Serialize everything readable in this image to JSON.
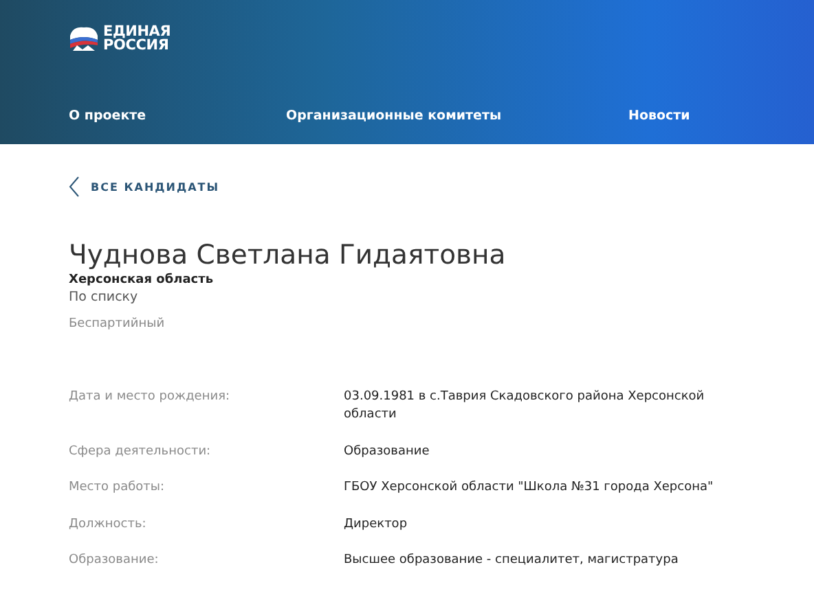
{
  "header": {
    "logo_lines": [
      "ЕДИНАЯ",
      "РОССИЯ"
    ],
    "nav": [
      {
        "label": "О проекте"
      },
      {
        "label": "Организационные комитеты"
      },
      {
        "label": "Новости"
      }
    ]
  },
  "back_link": "ВСЕ КАНДИДАТЫ",
  "candidate": {
    "name": "Чуднова Светлана Гидаятовна",
    "region": "Херсонская область",
    "list": "По списку",
    "party": "Беспартийный"
  },
  "details": [
    {
      "label": "Дата и место рождения:",
      "value": "03.09.1981 в с.Таврия Скадовского района Херсонской области"
    },
    {
      "label": "Сфера деятельности:",
      "value": "Образование"
    },
    {
      "label": "Место работы:",
      "value": "ГБОУ Херсонской области \"Школа №31 города Херсона\""
    },
    {
      "label": "Должность:",
      "value": "Директор"
    },
    {
      "label": "Образование:",
      "value": "Высшее образование - специалитет, магистратура"
    }
  ]
}
